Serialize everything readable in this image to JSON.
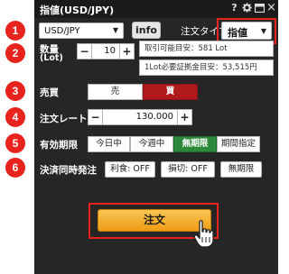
{
  "window": {
    "title": "指値(USD/JPY)",
    "icons": [
      "help-icon",
      "gear-icon",
      "window-icon",
      "close-icon"
    ],
    "help_glyph": "?",
    "close_glyph": "×"
  },
  "badges": [
    "1",
    "2",
    "3",
    "4",
    "5",
    "6"
  ],
  "row1": {
    "currency_pair": "USD/JPY",
    "info_label": "info",
    "order_type_label": "注文タイプ",
    "order_type_value": "指値"
  },
  "quantity": {
    "label_line1": "数量",
    "label_line2": "(Lot)",
    "minus": "−",
    "value": "10",
    "plus": "+",
    "available": "取引可能目安：581 Lot",
    "margin_per_lot": "1Lot必要証拠金目安：53,515円"
  },
  "side": {
    "label": "売買",
    "sell": "売",
    "buy": "買",
    "selected": "buy"
  },
  "rate": {
    "label": "注文レート",
    "minus": "−",
    "value": "130.000",
    "plus": "+"
  },
  "expiry": {
    "label": "有効期限",
    "options": [
      "今日中",
      "今週中",
      "無期限",
      "期間指定"
    ],
    "selected": "無期限"
  },
  "settlement": {
    "label": "決済同時発注",
    "take_profit": "利食: OFF",
    "stop_loss": "損切: OFF",
    "duration": "無期限"
  },
  "submit": {
    "label": "注文"
  },
  "colors": {
    "badge": "#e8231e",
    "highlight_frame": "#e8231e",
    "buy_selected": "#b11a1a",
    "expiry_selected": "#2d8a3b",
    "order_button": "#f4ad2c",
    "panel_bg": "#262626"
  }
}
